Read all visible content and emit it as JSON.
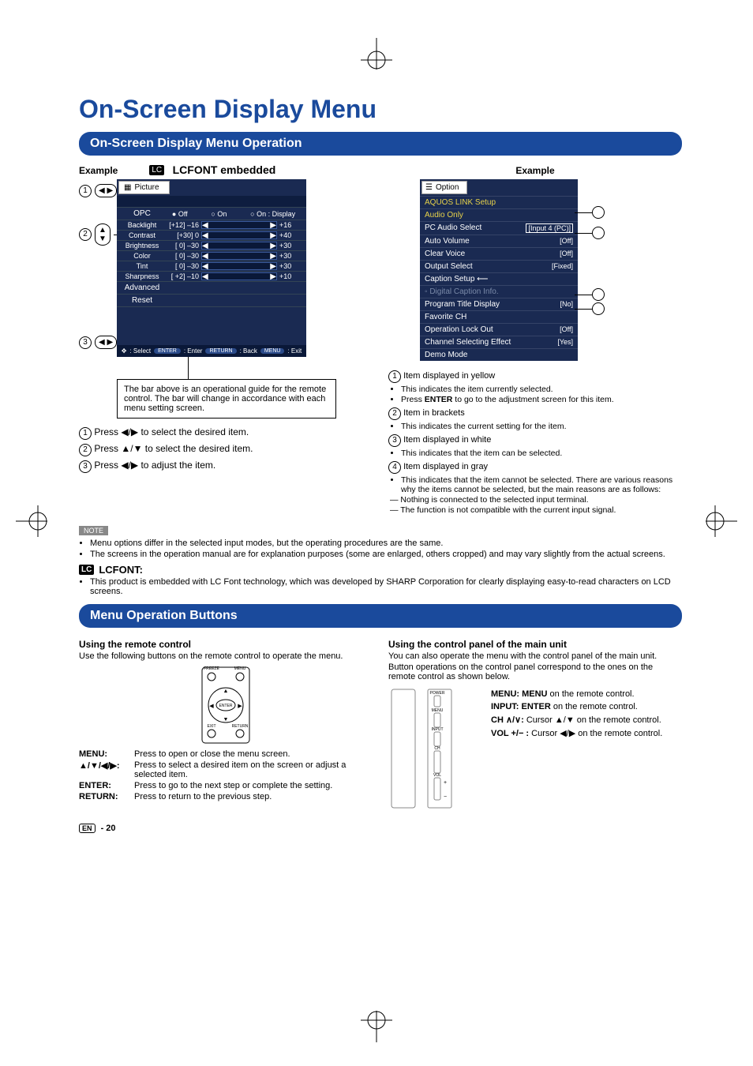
{
  "page_title": "On-Screen Display Menu",
  "section1_title": "On-Screen Display Menu Operation",
  "example_label": "Example",
  "lcfont_embedded": "LCFONT  embedded",
  "picture_menu": {
    "tab": "Picture",
    "opc": {
      "label": "OPC",
      "opts": [
        "Off",
        "On",
        "On : Display"
      ],
      "selected": 0
    },
    "rows": [
      {
        "label": "Backlight",
        "val": "[+12]  –16",
        "max": "+16",
        "pos": 35
      },
      {
        "label": "Contrast",
        "val": "[+30]     0",
        "max": "+40",
        "pos": 50
      },
      {
        "label": "Brightness",
        "val": "[   0]  –30",
        "max": "+30",
        "pos": 55
      },
      {
        "label": "Color",
        "val": "[   0]  –30",
        "max": "+30",
        "pos": 50
      },
      {
        "label": "Tint",
        "val": "[   0]  –30",
        "max": "+30",
        "pos": 55
      },
      {
        "label": "Sharpness",
        "val": "[ +2]  –10",
        "max": "+10",
        "pos": 60
      }
    ],
    "advanced": "Advanced",
    "reset": "Reset"
  },
  "guide_bar": {
    "select": ": Select",
    "enter": ": Enter",
    "back": ": Back",
    "exit": ": Exit",
    "enter_pill": "ENTER",
    "return_pill": "RETURN",
    "menu_pill": "MENU"
  },
  "guide_text": "The bar above is an operational guide for the remote control. The bar will change in accordance with each menu setting screen.",
  "steps": {
    "s1": "Press ◀/▶ to select the desired item.",
    "s2": "Press ▲/▼ to select the desired item.",
    "s3": "Press ◀/▶ to adjust the item."
  },
  "option_menu": {
    "tab": "Option",
    "rows": [
      {
        "label": "AQUOS LINK Setup",
        "val": "",
        "cls": "yellow"
      },
      {
        "label": "Audio Only",
        "val": "",
        "cls": "yellow"
      },
      {
        "label": "PC Audio Select",
        "val": "[Input 4 (PC)]",
        "cls": "brk"
      },
      {
        "label": "Auto Volume",
        "val": "[Off]",
        "cls": ""
      },
      {
        "label": "Clear Voice",
        "val": "[Off]",
        "cls": ""
      },
      {
        "label": "Output Select",
        "val": "[Fixed]",
        "cls": ""
      },
      {
        "label": "Caption Setup",
        "val": "",
        "cls": ""
      },
      {
        "label": "Digital Caption Info.",
        "val": "",
        "cls": "gray"
      },
      {
        "label": "Program Title Display",
        "val": "[No]",
        "cls": ""
      },
      {
        "label": "Favorite CH",
        "val": "",
        "cls": ""
      },
      {
        "label": "Operation Lock Out",
        "val": "[Off]",
        "cls": ""
      },
      {
        "label": "Channel Selecting Effect",
        "val": "[Yes]",
        "cls": ""
      },
      {
        "label": "Demo Mode",
        "val": "",
        "cls": ""
      }
    ]
  },
  "legend": {
    "i1": {
      "h": "Item displayed in yellow",
      "b": [
        "This indicates the item currently selected.",
        "Press ENTER to go to the adjustment screen for this item."
      ]
    },
    "i2": {
      "h": "Item in brackets",
      "b": [
        "This indicates the current setting for the item."
      ]
    },
    "i3": {
      "h": "Item displayed in white",
      "b": [
        "This indicates that the item can be selected."
      ]
    },
    "i4": {
      "h": "Item displayed in gray",
      "b": [
        "This indicates that the item cannot be selected. There are various reasons why the items cannot be selected, but the main reasons are as follows:",
        "— Nothing is connected to the selected input terminal.",
        "— The function is not compatible with the current input signal."
      ]
    }
  },
  "note_label": "NOTE",
  "notes": [
    "Menu options differ in the selected input modes, but the operating procedures are the same.",
    "The screens in the operation manual are for explanation purposes (some are enlarged, others cropped) and may vary slightly from the actual screens."
  ],
  "lcfont_hdr": "LCFONT:",
  "lcfont_note": "This product is embedded with LC Font technology, which was developed by SHARP Corporation for clearly displaying easy-to-read characters on LCD screens.",
  "section2_title": "Menu Operation Buttons",
  "remote": {
    "h": "Using the remote control",
    "p": "Use the following buttons on the remote control to operate the menu.",
    "labels": {
      "freeze": "FREEZE",
      "menu": "MENU",
      "enter": "ENTER",
      "exit": "EXIT",
      "return": "RETURN"
    },
    "table": [
      {
        "k": "MENU:",
        "d": "Press to open or close the menu screen."
      },
      {
        "k": "▲/▼/◀/▶:",
        "d": "Press to select a desired item on the screen or adjust a selected item."
      },
      {
        "k": "ENTER:",
        "d": "Press to go to the next step or complete the setting."
      },
      {
        "k": "RETURN:",
        "d": "Press to return to the previous step."
      }
    ]
  },
  "panel": {
    "h": "Using the control panel of the main unit",
    "p1": "You can also operate the menu with the control panel of the main unit.",
    "p2": "Button operations on the control panel correspond to the ones on the remote control as shown below.",
    "side": {
      "power": "POWER",
      "menu": "MENU",
      "input": "INPUT",
      "ch": "CH",
      "vol": "VOL"
    },
    "desc": [
      {
        "k": "MENU: MENU",
        "d": " on the remote control."
      },
      {
        "k": "INPUT: ENTER",
        "d": " on the remote control."
      },
      {
        "k": "CH ∧/∨:",
        "d": " Cursor ▲/▼ on the remote control."
      },
      {
        "k": "VOL +/− :",
        "d": " Cursor ◀/▶ on the remote control."
      }
    ]
  },
  "page_number": "20",
  "page_lang": "EN"
}
